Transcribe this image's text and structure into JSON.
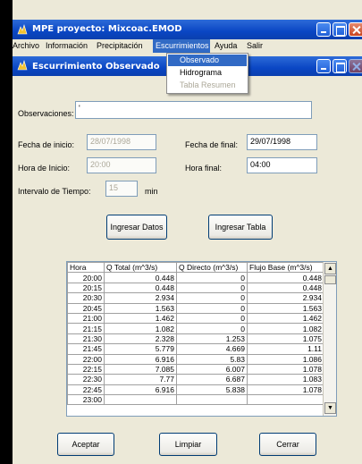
{
  "app": {
    "title": "MPE proyecto: Mixcoac.EMOD",
    "menu": [
      "Archivo",
      "Información",
      "Precipitación",
      "Escurrimientos",
      "Ayuda",
      "Salir"
    ],
    "active_menu_index": 3
  },
  "dropdown": {
    "items": [
      {
        "label": "Observado",
        "selected": true,
        "enabled": true
      },
      {
        "label": "Hidrograma",
        "selected": false,
        "enabled": true
      },
      {
        "label": "Tabla Resumen",
        "selected": false,
        "enabled": false
      }
    ]
  },
  "window": {
    "title": "Escurrimiento Observado"
  },
  "form": {
    "observaciones_label": "Observaciones:",
    "observaciones_value": "'",
    "fecha_inicio_label": "Fecha de inicio:",
    "fecha_inicio_value": "28/07/1998",
    "fecha_final_label": "Fecha de final:",
    "fecha_final_value": "29/07/1998",
    "hora_inicio_label": "Hora de Inicio:",
    "hora_inicio_value": "20:00",
    "hora_final_label": "Hora final:",
    "hora_final_value": "04:00",
    "intervalo_label": "Intervalo de Tiempo:",
    "intervalo_value": "15",
    "intervalo_unit": "min"
  },
  "buttons": {
    "ingresar_datos": "Ingresar Datos",
    "ingresar_tabla": "Ingresar Tabla",
    "aceptar": "Aceptar",
    "limpiar": "Limpiar",
    "cerrar": "Cerrar"
  },
  "table": {
    "columns": [
      "Hora",
      "Q Total (m^3/s)",
      "Q Directo (m^3/s)",
      "Flujo Base  (m^3/s)"
    ],
    "rows": [
      [
        "20:00",
        "0.448",
        "0",
        "0.448"
      ],
      [
        "20:15",
        "0.448",
        "0",
        "0.448"
      ],
      [
        "20:30",
        "2.934",
        "0",
        "2.934"
      ],
      [
        "20:45",
        "1.563",
        "0",
        "1.563"
      ],
      [
        "21:00",
        "1.462",
        "0",
        "1.462"
      ],
      [
        "21:15",
        "1.082",
        "0",
        "1.082"
      ],
      [
        "21:30",
        "2.328",
        "1.253",
        "1.075"
      ],
      [
        "21:45",
        "5.779",
        "4.669",
        "1.11"
      ],
      [
        "22:00",
        "6.916",
        "5.83",
        "1.086"
      ],
      [
        "22:15",
        "7.085",
        "6.007",
        "1.078"
      ],
      [
        "22:30",
        "7.77",
        "6.687",
        "1.083"
      ],
      [
        "22:45",
        "6.916",
        "5.838",
        "1.078"
      ],
      [
        "23:00",
        "",
        "",
        ""
      ]
    ]
  }
}
